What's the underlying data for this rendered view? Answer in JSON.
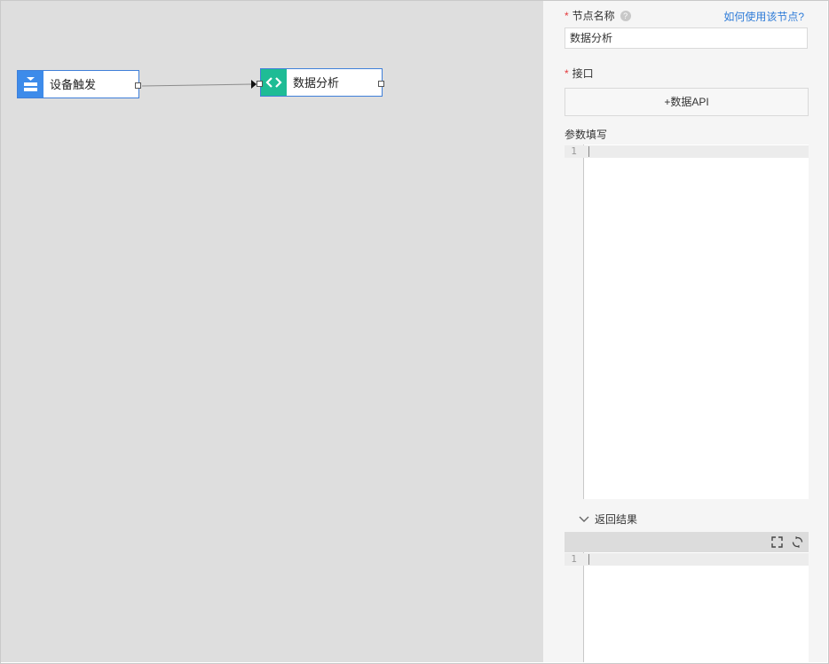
{
  "canvas": {
    "nodes": [
      {
        "label": "设备触发",
        "icon": "device-trigger-icon",
        "color": "#3d8bea"
      },
      {
        "label": "数据分析",
        "icon": "code-icon",
        "color": "#1ebc95"
      }
    ]
  },
  "panel": {
    "node_name": {
      "required_mark": "*",
      "label": "节点名称",
      "help_glyph": "?",
      "help_link": "如何使用该节点?",
      "value": "数据分析"
    },
    "interface": {
      "required_mark": "*",
      "label": "接口",
      "button_label": "+数据API"
    },
    "params": {
      "label": "参数填写",
      "line_number": "1"
    },
    "result": {
      "label": "返回结果",
      "line_number": "1"
    }
  },
  "colors": {
    "accent": "#2f7cd8",
    "node_border": "#3f7fd9",
    "required": "#e4393c"
  }
}
